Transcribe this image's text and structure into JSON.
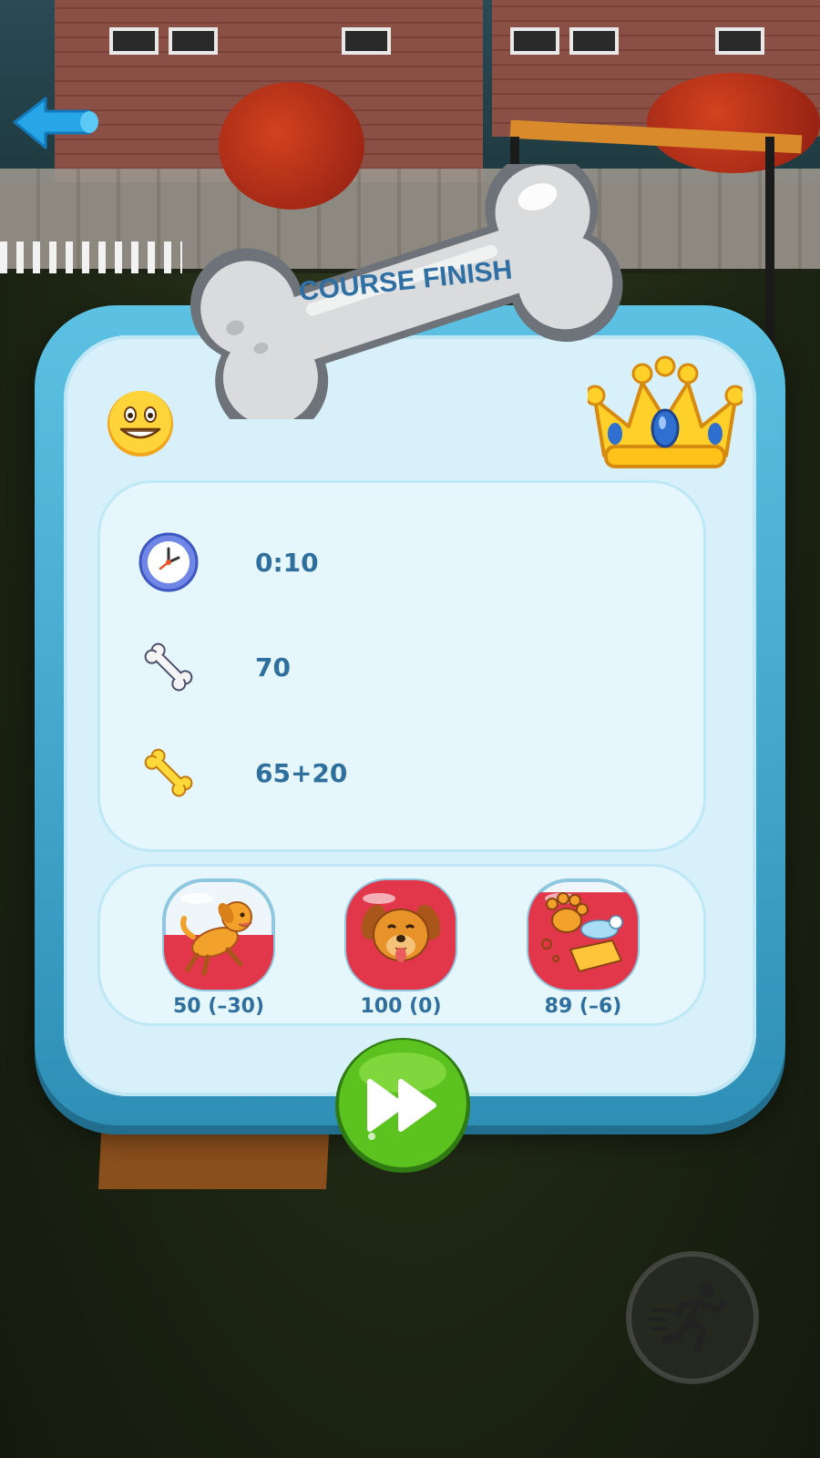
{
  "banner": {
    "title": "COURSE FINISH"
  },
  "stats": [
    {
      "icon": "clock-icon",
      "value": "0:10"
    },
    {
      "icon": "white-bone-icon",
      "value": "70"
    },
    {
      "icon": "gold-bone-icon",
      "value": "65+20"
    }
  ],
  "skills": [
    {
      "icon": "running-dog-icon",
      "label": "50 (–30)",
      "fill": 0.5
    },
    {
      "icon": "happy-dog-icon",
      "label": "100 (0)",
      "fill": 1.0
    },
    {
      "icon": "paw-soap-icon",
      "label": "89 (–6)",
      "fill": 0.89
    }
  ],
  "colors": {
    "panel_border": "#2f8fb6",
    "panel_fill": "#d7f0fa",
    "text": "#2f6f9e",
    "skill_red": "#e2364a",
    "next_green": "#5cc21f",
    "back_blue": "#26a6e8"
  },
  "icons": {
    "back": "back-arrow-icon",
    "next": "fast-forward-icon",
    "run": "running-man-icon",
    "smiley": "grinning-face-icon",
    "crown": "crown-icon"
  }
}
